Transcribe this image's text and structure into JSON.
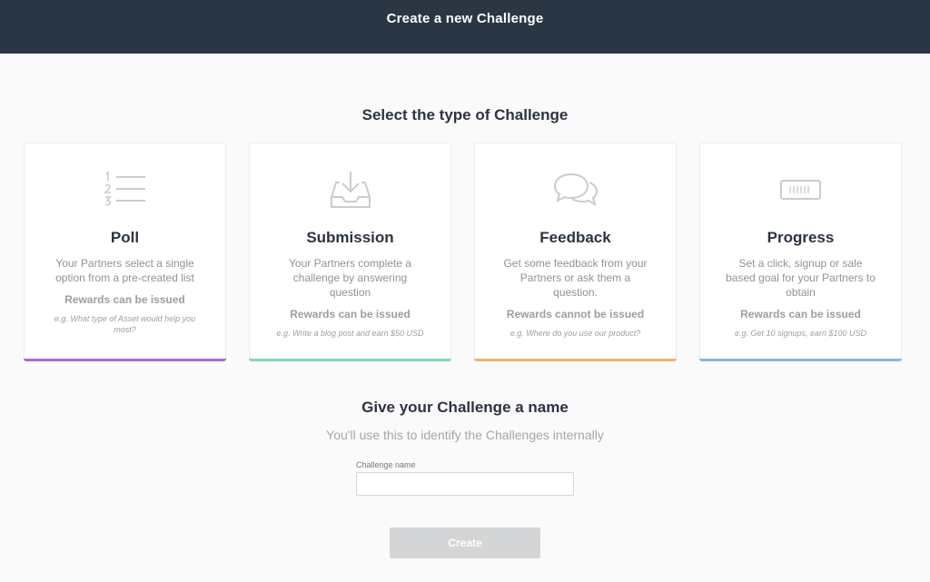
{
  "header": {
    "title": "Create a new Challenge"
  },
  "type_section": {
    "title": "Select the type of Challenge"
  },
  "cards": [
    {
      "icon": "numbered-list-icon",
      "name": "Poll",
      "description": "Your Partners select a single option from a pre-created list",
      "rewards": "Rewards can be issued",
      "example": "e.g. What type of Asset would help you most?",
      "accent_color": "#a56ed8"
    },
    {
      "icon": "inbox-download-icon",
      "name": "Submission",
      "description": "Your Partners complete a challenge by answering question",
      "rewards": "Rewards can be issued",
      "example": "e.g. Write a blog post and earn $50 USD",
      "accent_color": "#7fd8c0"
    },
    {
      "icon": "chat-bubbles-icon",
      "name": "Feedback",
      "description": "Get some feedback from your Partners or ask them a question.",
      "rewards": "Rewards cannot be issued",
      "example": "e.g. Where do you use our product?",
      "accent_color": "#f4b069"
    },
    {
      "icon": "progress-bar-icon",
      "name": "Progress",
      "description": "Set a click, signup or sale based goal for your Partners to obtain",
      "rewards": "Rewards can be issued",
      "example": "e.g. Get 10 signups, earn $100 USD",
      "accent_color": "#8ab3e0"
    }
  ],
  "name_section": {
    "title": "Give your Challenge a name",
    "subtitle": "You'll use this to identify the Challenges internally",
    "field_label": "Challenge name",
    "field_value": "",
    "field_placeholder": ""
  },
  "actions": {
    "create_label": "Create"
  }
}
